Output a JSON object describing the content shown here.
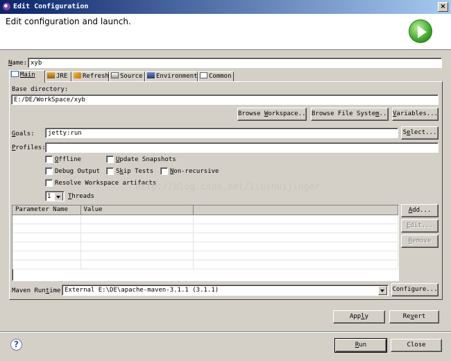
{
  "window": {
    "title": "Edit Configuration",
    "close_glyph": "×"
  },
  "banner": {
    "heading": "Edit configuration and launch."
  },
  "name": {
    "label": "Name:",
    "value": "xyb"
  },
  "tabs": [
    {
      "label": "Main",
      "icon": "main-tab-icon"
    },
    {
      "label": "JRE",
      "icon": "jre-icon"
    },
    {
      "label": "Refresh",
      "icon": "refresh-icon"
    },
    {
      "label": "Source",
      "icon": "source-icon"
    },
    {
      "label": "Environment",
      "icon": "environment-icon"
    },
    {
      "label": "Common",
      "icon": "common-icon"
    }
  ],
  "main": {
    "base_dir_label": "Base directory:",
    "base_dir_value": "E:/DE/WorkSpace/xyb",
    "browse_workspace": "Browse Workspace...",
    "browse_fs": "Browse File System...",
    "variables": "Variables...",
    "goals_label": "Goals:",
    "goals_value": "jetty:run",
    "select": "Select...",
    "profiles_label": "Profiles:",
    "profiles_value": "",
    "checkboxes": {
      "offline": "Offline",
      "update_snapshots": "Update Snapshots",
      "debug_output": "Debug Output",
      "skip_tests": "Skip Tests",
      "non_recursive": "Non-recursive",
      "resolve_workspace": "Resolve Workspace artifacts"
    },
    "threads_value": "1",
    "threads_label": "Threads",
    "watermark": "http://blog.csdn.net/liushuijinger",
    "params_table": {
      "columns": [
        "Parameter Name",
        "Value"
      ],
      "rows": []
    },
    "add": "Add...",
    "edit": "Edit...",
    "remove": "Remove",
    "runtime_label": "Maven Runtime:",
    "runtime_value": "External E:\\DE\\apache-maven-3.1.1 (3.1.1)",
    "configure": "Configure..."
  },
  "apply": "Apply",
  "revert": "Revert",
  "run": "Run",
  "close": "Close",
  "help_glyph": "?"
}
